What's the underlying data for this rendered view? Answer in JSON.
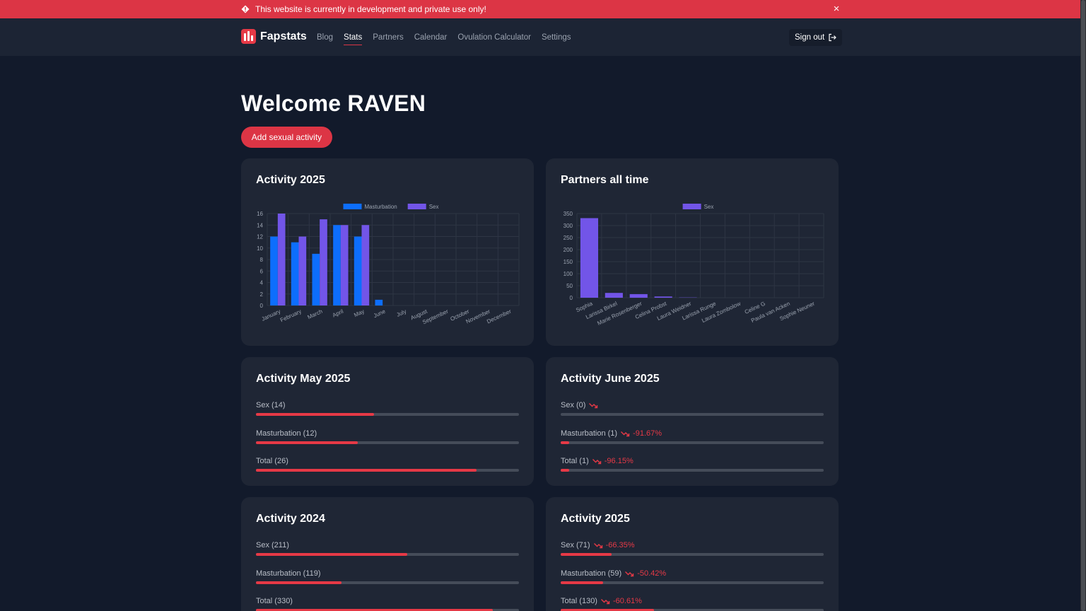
{
  "banner": {
    "text": "This website is currently in development and private use only!",
    "close": "×"
  },
  "brand": {
    "name": "Fapstats"
  },
  "nav": {
    "links": [
      "Blog",
      "Stats",
      "Partners",
      "Calendar",
      "Ovulation Calculator",
      "Settings"
    ],
    "active": "Stats",
    "signout": "Sign out"
  },
  "main": {
    "welcome": "Welcome RAVEN",
    "add_button": "Add sexual activity"
  },
  "colors": {
    "accent": "#dc3545",
    "masturbation": "#0d6efd",
    "sex": "#7255e8",
    "card": "#1f2635",
    "background": "#121a2b"
  },
  "cards": {
    "activity_chart": {
      "title": "Activity 2025"
    },
    "partners_chart": {
      "title": "Partners all time"
    },
    "may": {
      "title": "Activity May 2025",
      "items": [
        {
          "label": "Sex (14)",
          "trend": "",
          "fraction": 0.45
        },
        {
          "label": "Masturbation (12)",
          "trend": "",
          "fraction": 0.386
        },
        {
          "label": "Total (26)",
          "trend": "",
          "fraction": 0.839
        }
      ]
    },
    "june": {
      "title": "Activity June 2025",
      "items": [
        {
          "label": "Sex (0)",
          "trend": "",
          "fraction": 0
        },
        {
          "label": "Masturbation (1)",
          "trend": "-91.67%",
          "fraction": 0.032
        },
        {
          "label": "Total (1)",
          "trend": "-96.15%",
          "fraction": 0.032
        }
      ]
    },
    "year2024": {
      "title": "Activity 2024",
      "items": [
        {
          "label": "Sex (211)",
          "trend": "",
          "fraction": 0.575
        },
        {
          "label": "Masturbation (119)",
          "trend": "",
          "fraction": 0.324
        },
        {
          "label": "Total (330)",
          "trend": "",
          "fraction": 0.9
        }
      ]
    },
    "year2025": {
      "title": "Activity 2025",
      "items": [
        {
          "label": "Sex (71)",
          "trend": "-66.35%",
          "fraction": 0.194
        },
        {
          "label": "Masturbation (59)",
          "trend": "-50.42%",
          "fraction": 0.161
        },
        {
          "label": "Total (130)",
          "trend": "-60.61%",
          "fraction": 0.355
        }
      ]
    }
  },
  "chart_data": [
    {
      "type": "bar",
      "title": "Activity 2025",
      "categories": [
        "January",
        "February",
        "March",
        "April",
        "May",
        "June",
        "July",
        "August",
        "September",
        "October",
        "November",
        "December"
      ],
      "series": [
        {
          "name": "Masturbation",
          "values": [
            12,
            11,
            9,
            14,
            12,
            1,
            0,
            0,
            0,
            0,
            0,
            0
          ]
        },
        {
          "name": "Sex",
          "values": [
            16,
            12,
            15,
            14,
            14,
            0,
            0,
            0,
            0,
            0,
            0,
            0
          ]
        }
      ],
      "ylim": [
        0,
        16
      ],
      "yticks": [
        "0",
        "2",
        "4",
        "6",
        "8",
        "10",
        "12",
        "14",
        "16"
      ],
      "grid": true,
      "legend": "top-center"
    },
    {
      "type": "bar",
      "title": "Partners all time",
      "categories": [
        "Sophia",
        "Larissa Birkel",
        "Marie Rosenberger",
        "Celina Probst",
        "Laura Weidner",
        "Larissa Runge",
        "Laura Zombolow",
        "Celine G",
        "Paula van Acken",
        "Sophie Neuner"
      ],
      "series": [
        {
          "name": "Sex",
          "values": [
            331,
            20,
            15,
            5,
            1,
            0,
            0,
            0,
            0,
            0
          ]
        }
      ],
      "ylim": [
        0,
        350
      ],
      "yticks": [
        "0",
        "50",
        "100",
        "150",
        "200",
        "250",
        "300",
        "350"
      ],
      "grid": true,
      "legend": "top-center"
    }
  ]
}
